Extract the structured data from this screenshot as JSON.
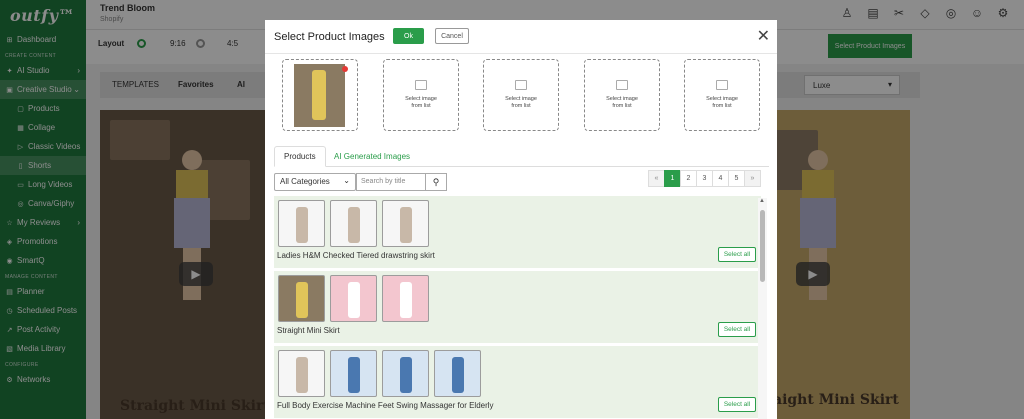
{
  "sidebar": {
    "logo": "outfy™",
    "items": [
      {
        "icon": "dashboard-icon",
        "glyph": "⊞",
        "label": "Dashboard",
        "active": false,
        "sub": false
      },
      {
        "section": "CREATE CONTENT"
      },
      {
        "icon": "ai-studio-icon",
        "glyph": "✦",
        "label": "AI Studio",
        "active": false,
        "sub": false,
        "chevron": "›"
      },
      {
        "icon": "creative-studio-icon",
        "glyph": "▣",
        "label": "Creative Studio",
        "active": true,
        "sub": false,
        "chevron": "⌄"
      },
      {
        "icon": "products-icon",
        "glyph": "▢",
        "label": "Products",
        "sub": true
      },
      {
        "icon": "collage-icon",
        "glyph": "▦",
        "label": "Collage",
        "sub": true
      },
      {
        "icon": "classic-videos-icon",
        "glyph": "▷",
        "label": "Classic Videos",
        "sub": true
      },
      {
        "icon": "shorts-icon",
        "glyph": "▯",
        "label": "Shorts",
        "sub": true,
        "active": true
      },
      {
        "icon": "long-videos-icon",
        "glyph": "▭",
        "label": "Long Videos",
        "sub": true
      },
      {
        "icon": "canva-giphy-icon",
        "glyph": "◎",
        "label": "Canva/Giphy",
        "sub": true
      },
      {
        "icon": "reviews-icon",
        "glyph": "☆",
        "label": "My Reviews",
        "sub": false,
        "chevron": "›"
      },
      {
        "icon": "promotions-icon",
        "glyph": "◈",
        "label": "Promotions",
        "sub": false
      },
      {
        "icon": "smartq-icon",
        "glyph": "◉",
        "label": "SmartQ",
        "sub": false
      },
      {
        "section": "MANAGE CONTENT"
      },
      {
        "icon": "planner-icon",
        "glyph": "▤",
        "label": "Planner",
        "sub": false
      },
      {
        "icon": "scheduled-posts-icon",
        "glyph": "◷",
        "label": "Scheduled Posts",
        "sub": false
      },
      {
        "icon": "post-activity-icon",
        "glyph": "↗",
        "label": "Post Activity",
        "sub": false
      },
      {
        "icon": "media-library-icon",
        "glyph": "▧",
        "label": "Media Library",
        "sub": false
      },
      {
        "section": "CONFIGURE"
      },
      {
        "icon": "networks-icon",
        "glyph": "⚙",
        "label": "Networks",
        "sub": false
      }
    ]
  },
  "topbar": {
    "store_name": "Trend Bloom",
    "platform": "Shopify",
    "icons": [
      {
        "name": "user-icon",
        "glyph": "♙"
      },
      {
        "name": "billing-icon",
        "glyph": "▤"
      },
      {
        "name": "tools-icon",
        "glyph": "✂"
      },
      {
        "name": "diamond-icon",
        "glyph": "◇"
      },
      {
        "name": "help-icon",
        "glyph": "◎"
      },
      {
        "name": "support-icon",
        "glyph": "☺"
      },
      {
        "name": "settings-icon",
        "glyph": "⚙"
      }
    ]
  },
  "layout": {
    "label": "Layout",
    "options": [
      "9:16",
      "4:5"
    ],
    "selected": "9:16",
    "select_images_button": "Select Product Images"
  },
  "templates_bar": {
    "label": "TEMPLATES",
    "tabs": [
      "Favorites",
      "AI"
    ],
    "style_select": "Luxe"
  },
  "previews": {
    "caption_left": "Straight Mini Skirt",
    "caption_right": "aight Mini Skirt"
  },
  "modal": {
    "title": "Select Product Images",
    "ok_label": "Ok",
    "cancel_label": "Cancel",
    "slots": [
      {
        "filled": true
      },
      {
        "filled": false,
        "line1": "Select image",
        "line2": "from list"
      },
      {
        "filled": false,
        "line1": "Select image",
        "line2": "from list"
      },
      {
        "filled": false,
        "line1": "Select image",
        "line2": "from list"
      },
      {
        "filled": false,
        "line1": "Select image",
        "line2": "from list"
      }
    ],
    "tabs": [
      "Products",
      "AI Generated Images"
    ],
    "active_tab": "Products",
    "category_select": "All Categories",
    "search_placeholder": "Search by title",
    "pagination": {
      "prev": "«",
      "pages": [
        "1",
        "2",
        "3",
        "4",
        "5"
      ],
      "next": "»",
      "current": "1"
    },
    "products": [
      {
        "name": "Ladies H&M Checked Tiered drawstring skirt",
        "select_all": "Select all",
        "thumbs": [
          "white",
          "white",
          "white"
        ]
      },
      {
        "name": "Straight Mini Skirt",
        "select_all": "Select all",
        "thumbs": [
          "photo",
          "pink",
          "pink"
        ]
      },
      {
        "name": "Full Body Exercise Machine Feet Swing Massager for Elderly",
        "select_all": "Select all",
        "thumbs": [
          "white",
          "blue",
          "blue",
          "blue"
        ]
      }
    ]
  },
  "colors": {
    "brand_green": "#2a9d4a",
    "sidebar_green": "#1f7a3f",
    "product_row_bg": "#eaf2e6"
  }
}
